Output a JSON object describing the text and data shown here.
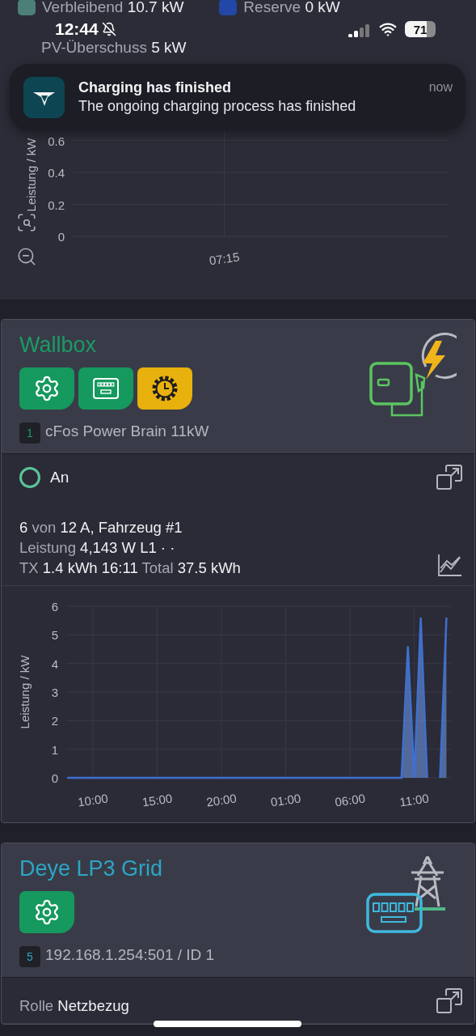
{
  "top_legend": [
    {
      "label": "Verbleibend",
      "value": "10.7 kW",
      "color": "#4d7f79"
    },
    {
      "label": "Reserve",
      "value": "0 kW",
      "color": "#2347a6"
    },
    {
      "label": "PV-Überschuss",
      "value": "5 kW"
    }
  ],
  "status_bar": {
    "time": "12:44",
    "battery": "71"
  },
  "notification": {
    "title": "Charging has finished",
    "body": "The ongoing charging process has finished",
    "time": "now"
  },
  "top_chart": {
    "chart_data": {
      "type": "line",
      "grid": true,
      "ylabel": "Leistung / kW",
      "ylim": [
        0,
        0.77
      ],
      "yticks": [
        0,
        0.2,
        0.4,
        0.6
      ],
      "categories": [
        null,
        "07:15",
        null
      ]
    }
  },
  "devices": [
    {
      "kind": "wallbox",
      "title": "Wallbox",
      "color": "#1c9a66",
      "buttons": [
        {
          "kind": "settings",
          "color": "#15995e"
        },
        {
          "kind": "meter",
          "color": "#15995e"
        },
        {
          "kind": "schedule",
          "color": "#e8b10d"
        }
      ],
      "badge": "1",
      "subtitle": "cFos Power Brain 11kW",
      "status": {
        "label": "An",
        "on": true
      },
      "lines": [
        [
          {
            "text": "6",
            "muted": false
          },
          {
            "text": "von",
            "muted": true
          },
          {
            "text": "12 A, Fahrzeug #1",
            "muted": false
          }
        ],
        [
          {
            "text": "Leistung",
            "muted": true
          },
          {
            "text": "4,143 W L1 · ·",
            "muted": false
          }
        ],
        [
          {
            "text": "TX",
            "muted": true
          },
          {
            "text": "1.4 kWh 16:11",
            "muted": false
          },
          {
            "text": "Total",
            "muted": true
          },
          {
            "text": "37.5 kWh",
            "muted": false
          }
        ]
      ],
      "chart_data": {
        "type": "area",
        "grid": true,
        "ylabel": "Leistung / kW",
        "ylim": [
          0,
          6
        ],
        "yticks": [
          0,
          1,
          2,
          3,
          4,
          5,
          6
        ],
        "categories": [
          null,
          null,
          null,
          null,
          "10:00",
          null,
          null,
          null,
          null,
          null,
          null,
          null,
          null,
          null,
          "15:00",
          null,
          null,
          null,
          null,
          null,
          null,
          null,
          null,
          null,
          "20:00",
          null,
          null,
          null,
          null,
          null,
          null,
          null,
          null,
          null,
          "01:00",
          null,
          null,
          null,
          null,
          null,
          null,
          null,
          null,
          null,
          "06:00",
          null,
          null,
          null,
          null,
          null,
          null,
          null,
          null,
          null,
          "11:00",
          null,
          null,
          null,
          null,
          null
        ],
        "series": [
          {
            "color": "#3f6fd0",
            "values": [
              0,
              0,
              0,
              0,
              0,
              0,
              0,
              0,
              0,
              0,
              0,
              0,
              0,
              0,
              0,
              0,
              0,
              0,
              0,
              0,
              0,
              0,
              0,
              0,
              0,
              0,
              0,
              0,
              0,
              0,
              0,
              0,
              0,
              0,
              0,
              0,
              0,
              0,
              0,
              0,
              0,
              0,
              0,
              0,
              0,
              0,
              0,
              0,
              0,
              0,
              0,
              0,
              0,
              4.6,
              0,
              5.6,
              0,
              null,
              0,
              5.6
            ]
          }
        ]
      }
    },
    {
      "kind": "grid",
      "title": "Deye LP3 Grid",
      "color": "#2ba6c6",
      "buttons": [
        {
          "kind": "settings",
          "color": "#15995e"
        }
      ],
      "badge": "5",
      "subtitle": "192.168.1.254:501 / ID 1",
      "lines": [
        [
          {
            "text": "Rolle",
            "muted": true
          },
          {
            "text": "Netzbezug",
            "muted": false
          }
        ]
      ]
    }
  ]
}
